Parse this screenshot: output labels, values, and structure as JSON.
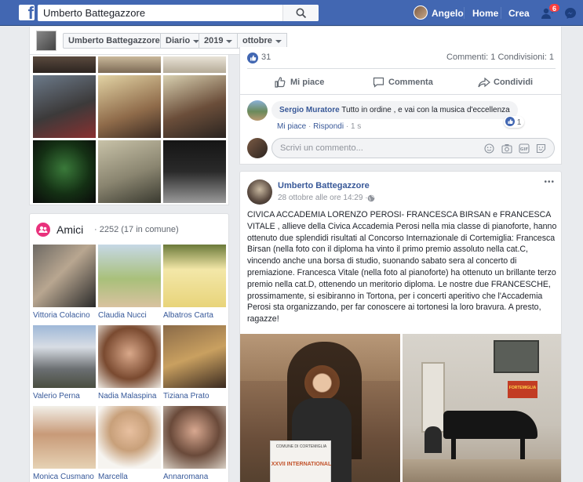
{
  "topbar": {
    "search_value": "Umberto Battegazzore",
    "user_name": "Angelo",
    "home": "Home",
    "create": "Crea",
    "notification_count": "6"
  },
  "timeline_nav": {
    "name": "Umberto Battegazzore",
    "section": "Diario",
    "year": "2019",
    "month": "ottobre"
  },
  "friends": {
    "title": "Amici",
    "count": "· 2252 (17 in comune)",
    "items": [
      {
        "name": "Vittoria Colacino"
      },
      {
        "name": "Claudia Nucci"
      },
      {
        "name": "Albatros Carta"
      },
      {
        "name": "Valerio Perna"
      },
      {
        "name": "Nadia Malaspina"
      },
      {
        "name": "Tiziana Prato"
      },
      {
        "name": "Monica Cusmano"
      },
      {
        "name": "Marcella"
      },
      {
        "name": "Annaromana"
      }
    ]
  },
  "post1": {
    "reactions_count": "31",
    "comments_shares": "Commenti: 1 Condivisioni: 1",
    "like_label": "Mi piace",
    "comment_label": "Commenta",
    "share_label": "Condividi",
    "comment": {
      "author": "Sergio Muratore",
      "text": "Tutto in ordine , e vai con la musica d'eccellenza",
      "like": "Mi piace",
      "reply": "Rispondi",
      "time": "1 s",
      "likes": "1"
    },
    "comment_placeholder": "Scrivi un commento..."
  },
  "post2": {
    "author": "Umberto Battegazzore",
    "time": "28 ottobre alle ore 14:29 ·",
    "more": "•••",
    "text": "CIVICA ACCADEMIA LORENZO PEROSI- FRANCESCA BIRSAN e FRANCESCA VITALE , allieve della Civica Accademia Perosi nella mia classe di pianoforte, hanno ottenuto due splendidi risultati al Concorso Internazionale di Cortemiglia: Francesca Birsan (nella foto con il diploma ha vinto il primo premio assoluto nella cat.C, vincendo anche una borsa di studio, suonando sabato sera al concerto di premiazione. Francesca Vitale (nella foto al pianoforte) ha ottenuto un brillante terzo premio nella cat.D, ottenendo un meritorio diploma. Le nostre due FRANCESCHE, prossimamente, si esibiranno in Tortona, per i concerti aperitivo che l'Accademia Perosi sta organizzando, per far conoscere ai tortonesi la loro bravura. A presto, ragazze!",
    "photo1_caption": "XXVII INTERNATIONAL",
    "photo1_sub": "COMUNE DI CORTEMIGLIA",
    "photo2_banner": "FORTEMIGLIA"
  },
  "colors": {
    "brand": "#4267b2",
    "link": "#385898",
    "friends_accent": "#e9317c"
  }
}
